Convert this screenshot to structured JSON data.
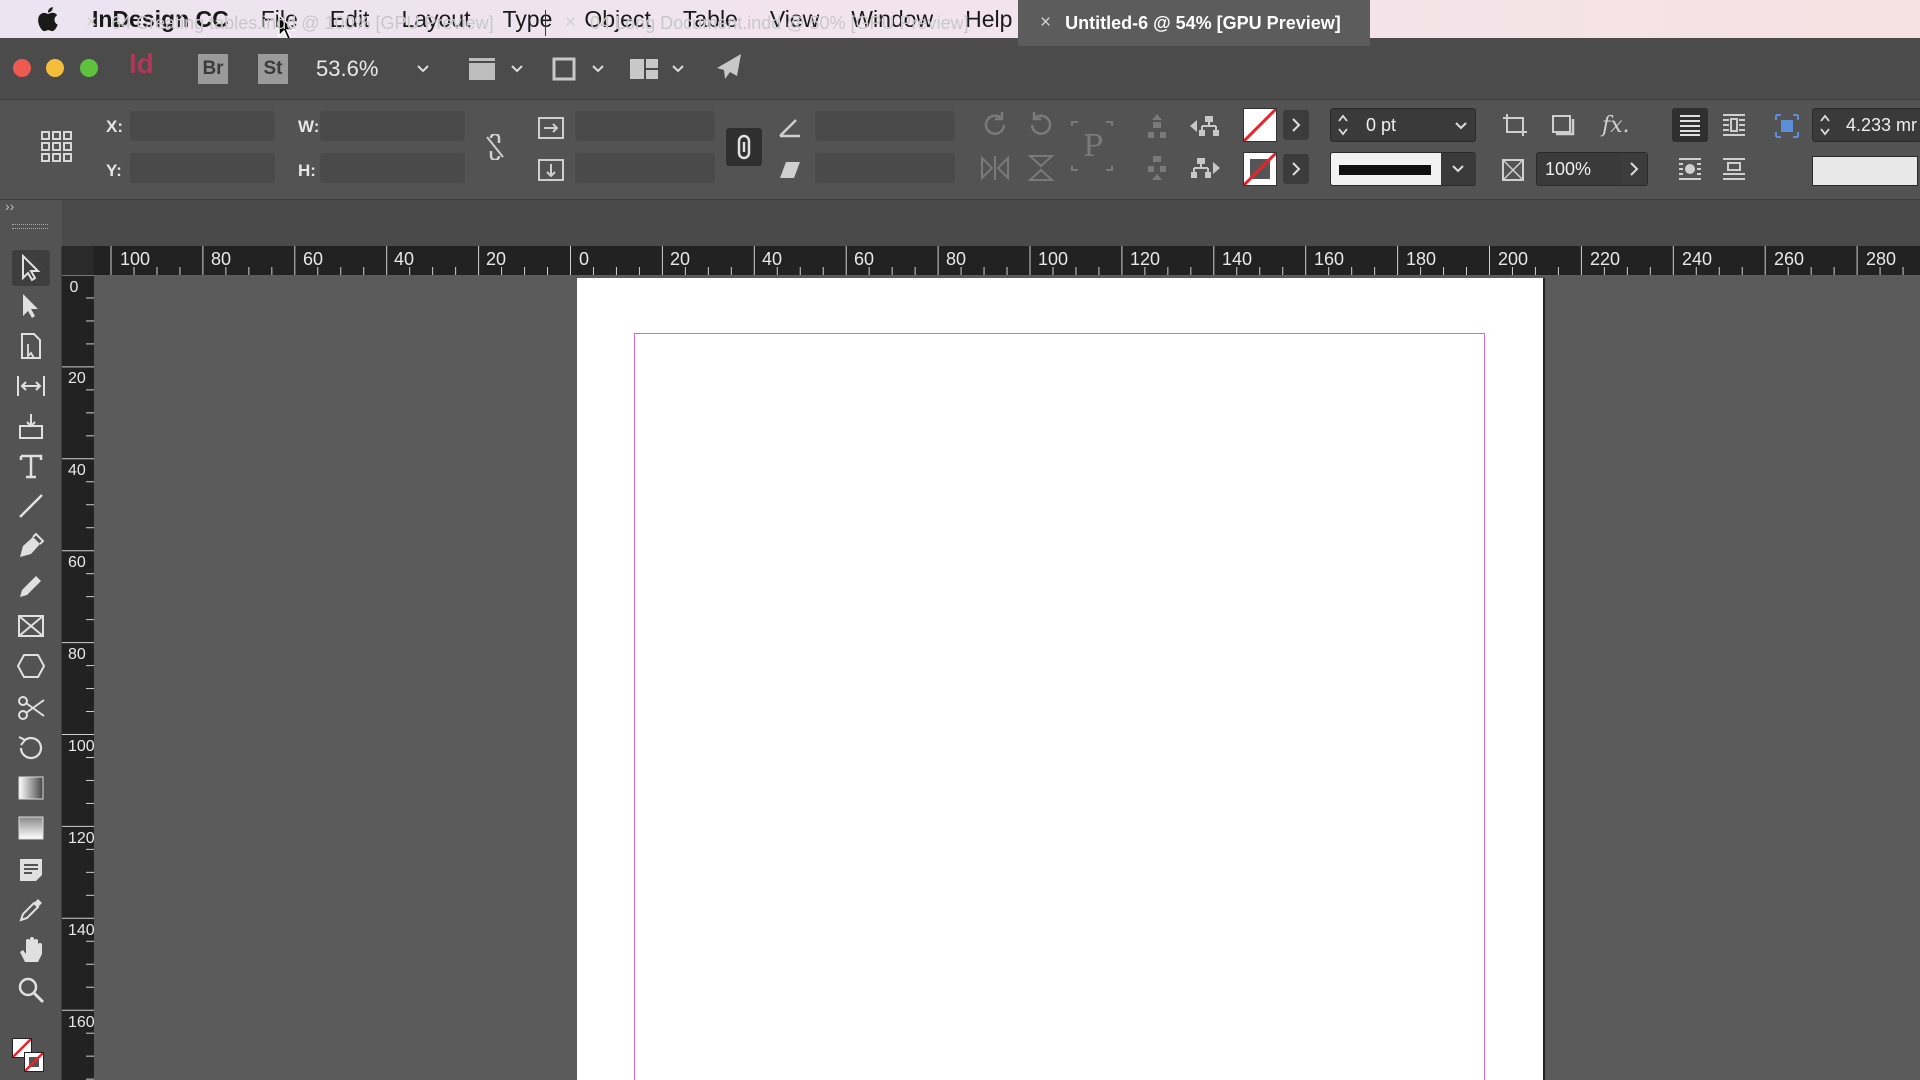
{
  "menubar": {
    "app_name": "InDesign CC",
    "items": [
      "File",
      "Edit",
      "Layout",
      "Type",
      "Object",
      "Table",
      "View",
      "Window",
      "Help"
    ]
  },
  "appbar": {
    "logo": "Id",
    "bridge_label": "Br",
    "stock_label": "St",
    "zoom": "53.6%"
  },
  "control": {
    "x_label": "X:",
    "y_label": "Y:",
    "w_label": "W:",
    "h_label": "H:",
    "stroke_weight": "0 pt",
    "opacity": "100%",
    "column_gutter": "4.233 mr"
  },
  "tabs": [
    {
      "label": "64 Creating tables.indd @ 100% [GPU Preview]",
      "active": false
    },
    {
      "label": "04 Long Document.indd @ 50% [GPU Preview]",
      "active": false
    },
    {
      "label": "Untitled-6 @ 54% [GPU Preview]",
      "active": true
    }
  ],
  "tab_close": "×",
  "panel_expand": "››",
  "ruler": {
    "horizontal": [
      "100",
      "80",
      "60",
      "40",
      "20",
      "0",
      "20",
      "40",
      "60",
      "80",
      "100",
      "120",
      "140",
      "160",
      "180",
      "200",
      "220",
      "240",
      "260",
      "280"
    ],
    "vertical": [
      "0",
      "20",
      "40",
      "60",
      "80",
      "100",
      "120",
      "140",
      "160"
    ]
  },
  "tools": [
    "selection-tool",
    "direct-selection-tool",
    "page-tool",
    "gap-tool",
    "content-collector-tool",
    "type-tool",
    "line-tool",
    "pen-tool",
    "pencil-tool",
    "rectangle-frame-tool",
    "polygon-tool",
    "scissors-tool",
    "free-transform-tool",
    "gradient-swatch-tool",
    "gradient-feather-tool",
    "note-tool",
    "eyedropper-tool",
    "hand-tool",
    "zoom-tool"
  ],
  "colors": {
    "menubar": "#f0e4ec",
    "panel": "#535353",
    "pasteboard": "#5b5b5b",
    "margin_guide": "#d36ad8",
    "indesign_accent": "#c0345f"
  }
}
